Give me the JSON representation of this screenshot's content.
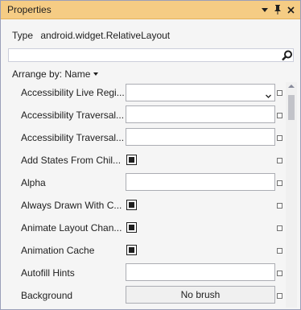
{
  "panel": {
    "title": "Properties",
    "buttons": {
      "menu": "dropdown-arrow",
      "pin": "pin",
      "close": "close"
    }
  },
  "type_line": {
    "label": "Type",
    "value": "android.widget.RelativeLayout"
  },
  "search": {
    "value": "",
    "placeholder": ""
  },
  "arrange": {
    "label": "Arrange by: Name"
  },
  "properties": [
    {
      "label": "Accessibility Live Regi...",
      "editor": "dropdown",
      "value": ""
    },
    {
      "label": "Accessibility Traversal...",
      "editor": "text",
      "value": ""
    },
    {
      "label": "Accessibility Traversal...",
      "editor": "text",
      "value": ""
    },
    {
      "label": "Add States From Chil...",
      "editor": "checkbox",
      "value": "indeterminate"
    },
    {
      "label": "Alpha",
      "editor": "text",
      "value": ""
    },
    {
      "label": "Always Drawn With C...",
      "editor": "checkbox",
      "value": "indeterminate"
    },
    {
      "label": "Animate Layout Chan...",
      "editor": "checkbox",
      "value": "indeterminate"
    },
    {
      "label": "Animation Cache",
      "editor": "checkbox",
      "value": "indeterminate"
    },
    {
      "label": "Autofill Hints",
      "editor": "text",
      "value": ""
    },
    {
      "label": "Background",
      "editor": "brush",
      "value": "No brush"
    }
  ],
  "colors": {
    "title_bar": "#f5cc84",
    "border": "#9b9fb9",
    "panel_bg": "#f5f5f5"
  }
}
